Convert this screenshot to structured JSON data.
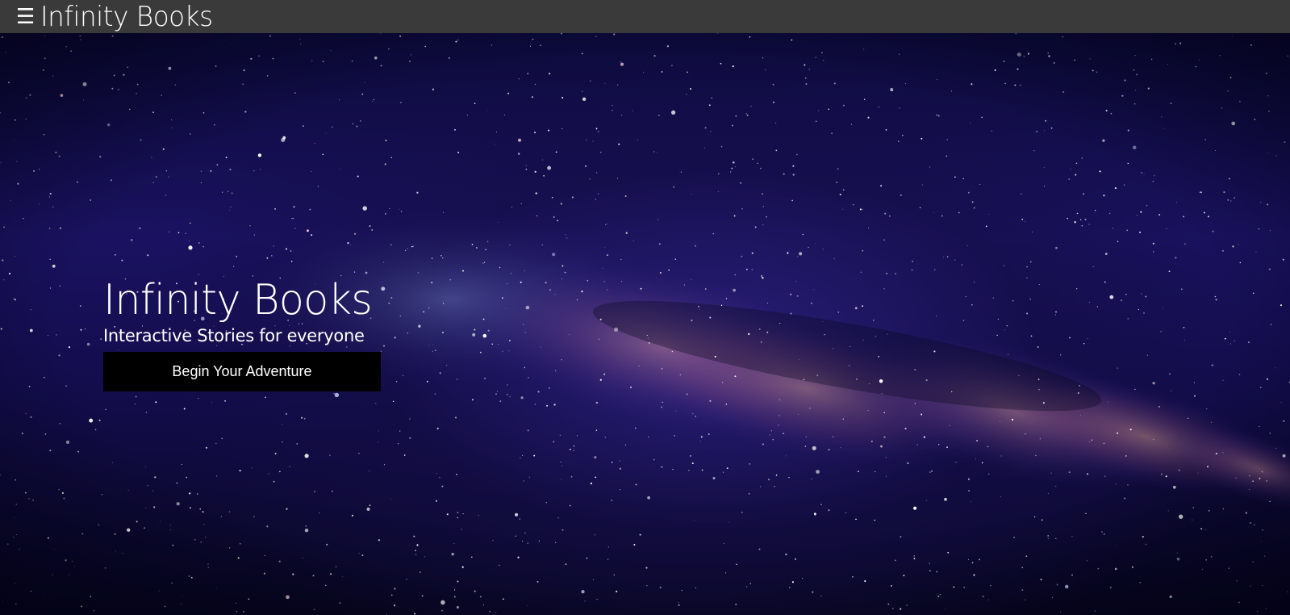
{
  "navbar": {
    "menu_icon": "☰",
    "brand": "Infinity Books"
  },
  "hero": {
    "background": "starry-night-milky-way",
    "title": "Infinity Books",
    "subtitle": "Interactive Stories for everyone",
    "cta_label": "Begin Your Adventure"
  },
  "colors": {
    "navbar_bg": "#3a3a3a",
    "button_bg": "#000000",
    "text": "#ffffff",
    "sky": "#1a1260"
  }
}
